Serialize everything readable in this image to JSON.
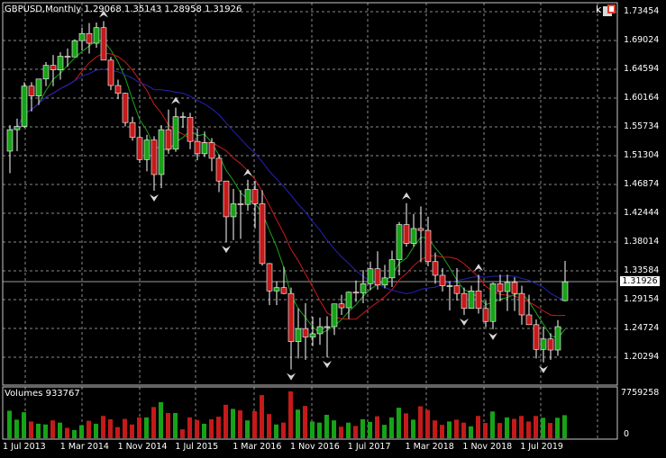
{
  "header": {
    "title": "GBPUSD,Monthly  1.29068 1.35143 1.28958 1.31926",
    "volume_label": "Volumes 933767",
    "corner_button": "k"
  },
  "price_axis": {
    "labels": [
      "1.73454",
      "1.69024",
      "1.64594",
      "1.60164",
      "1.55734",
      "1.51304",
      "1.46874",
      "1.42444",
      "1.38014",
      "1.33584",
      "1.29154",
      "1.24724",
      "1.20294"
    ],
    "current_price": "1.31926"
  },
  "volume_axis": {
    "labels": [
      "7759258",
      "0"
    ]
  },
  "time_axis": {
    "labels": [
      "1 Jul 2013",
      "1 Mar 2014",
      "1 Nov 2014",
      "1 Jul 2015",
      "1 Mar 2016",
      "1 Nov 2016",
      "1 Jul 2017",
      "1 Mar 2018",
      "1 Nov 2018",
      "1 Jul 2019"
    ]
  },
  "colors": {
    "bull": "#17a317",
    "bear": "#c41a1a",
    "ma_fast": "#1aa31a",
    "ma_mid": "#cc1a1a",
    "ma_slow": "#2323b8",
    "grid": "#8a8a8a"
  },
  "chart_data": {
    "type": "candlestick",
    "symbol": "GBPUSD",
    "timeframe": "Monthly",
    "start": "2013-07",
    "candles": [
      [
        1.52,
        1.56,
        1.486,
        1.553
      ],
      [
        1.553,
        1.57,
        1.52,
        1.558
      ],
      [
        1.558,
        1.626,
        1.556,
        1.62
      ],
      [
        1.62,
        1.626,
        1.581,
        1.605
      ],
      [
        1.605,
        1.63,
        1.591,
        1.631
      ],
      [
        1.631,
        1.657,
        1.62,
        1.652
      ],
      [
        1.652,
        1.668,
        1.62,
        1.645
      ],
      [
        1.645,
        1.672,
        1.63,
        1.666
      ],
      [
        1.666,
        1.678,
        1.65,
        1.665
      ],
      [
        1.665,
        1.692,
        1.67,
        1.69
      ],
      [
        1.69,
        1.71,
        1.675,
        1.701
      ],
      [
        1.701,
        1.717,
        1.67,
        1.686
      ],
      [
        1.686,
        1.718,
        1.679,
        1.71
      ],
      [
        1.71,
        1.72,
        1.66,
        1.66
      ],
      [
        1.66,
        1.665,
        1.614,
        1.621
      ],
      [
        1.621,
        1.63,
        1.6,
        1.609
      ],
      [
        1.609,
        1.61,
        1.558,
        1.564
      ],
      [
        1.564,
        1.573,
        1.536,
        1.541
      ],
      [
        1.541,
        1.558,
        1.502,
        1.507
      ],
      [
        1.507,
        1.545,
        1.489,
        1.537
      ],
      [
        1.537,
        1.543,
        1.459,
        1.484
      ],
      [
        1.484,
        1.56,
        1.463,
        1.553
      ],
      [
        1.553,
        1.584,
        1.516,
        1.523
      ],
      [
        1.523,
        1.587,
        1.519,
        1.573
      ],
      [
        1.573,
        1.58,
        1.556,
        1.572
      ],
      [
        1.572,
        1.579,
        1.523,
        1.535
      ],
      [
        1.535,
        1.555,
        1.506,
        1.516
      ],
      [
        1.516,
        1.55,
        1.511,
        1.533
      ],
      [
        1.533,
        1.54,
        1.489,
        1.509
      ],
      [
        1.509,
        1.515,
        1.457,
        1.474
      ],
      [
        1.474,
        1.47,
        1.38,
        1.419
      ],
      [
        1.419,
        1.462,
        1.383,
        1.439
      ],
      [
        1.439,
        1.46,
        1.385,
        1.438
      ],
      [
        1.438,
        1.476,
        1.428,
        1.461
      ],
      [
        1.461,
        1.474,
        1.401,
        1.439
      ],
      [
        1.439,
        1.46,
        1.344,
        1.347
      ],
      [
        1.347,
        1.348,
        1.283,
        1.305
      ],
      [
        1.305,
        1.32,
        1.283,
        1.31
      ],
      [
        1.31,
        1.342,
        1.3,
        1.301
      ],
      [
        1.301,
        1.31,
        1.184,
        1.227
      ],
      [
        1.227,
        1.278,
        1.201,
        1.247
      ],
      [
        1.247,
        1.286,
        1.199,
        1.234
      ],
      [
        1.234,
        1.265,
        1.22,
        1.239
      ],
      [
        1.239,
        1.264,
        1.222,
        1.25
      ],
      [
        1.25,
        1.266,
        1.203,
        1.25
      ],
      [
        1.25,
        1.285,
        1.237,
        1.285
      ],
      [
        1.285,
        1.299,
        1.268,
        1.279
      ],
      [
        1.279,
        1.304,
        1.262,
        1.303
      ],
      [
        1.303,
        1.321,
        1.288,
        1.302
      ],
      [
        1.302,
        1.337,
        1.286,
        1.316
      ],
      [
        1.316,
        1.35,
        1.306,
        1.339
      ],
      [
        1.339,
        1.366,
        1.307,
        1.314
      ],
      [
        1.314,
        1.345,
        1.309,
        1.325
      ],
      [
        1.325,
        1.367,
        1.311,
        1.353
      ],
      [
        1.353,
        1.411,
        1.329,
        1.407
      ],
      [
        1.407,
        1.44,
        1.373,
        1.378
      ],
      [
        1.378,
        1.423,
        1.373,
        1.401
      ],
      [
        1.401,
        1.435,
        1.349,
        1.398
      ],
      [
        1.398,
        1.419,
        1.343,
        1.35
      ],
      [
        1.35,
        1.364,
        1.316,
        1.329
      ],
      [
        1.329,
        1.34,
        1.304,
        1.313
      ],
      [
        1.313,
        1.32,
        1.275,
        1.313
      ],
      [
        1.313,
        1.34,
        1.29,
        1.301
      ],
      [
        1.301,
        1.31,
        1.268,
        1.278
      ],
      [
        1.278,
        1.313,
        1.281,
        1.305
      ],
      [
        1.305,
        1.33,
        1.27,
        1.278
      ],
      [
        1.278,
        1.29,
        1.249,
        1.258
      ],
      [
        1.258,
        1.318,
        1.246,
        1.316
      ],
      [
        1.316,
        1.33,
        1.289,
        1.304
      ],
      [
        1.304,
        1.33,
        1.274,
        1.318
      ],
      [
        1.318,
        1.326,
        1.274,
        1.301
      ],
      [
        1.301,
        1.313,
        1.253,
        1.268
      ],
      [
        1.268,
        1.299,
        1.254,
        1.253
      ],
      [
        1.253,
        1.261,
        1.201,
        1.215
      ],
      [
        1.215,
        1.25,
        1.195,
        1.231
      ],
      [
        1.231,
        1.24,
        1.199,
        1.214
      ],
      [
        1.214,
        1.26,
        1.205,
        1.25
      ],
      [
        1.29,
        1.351,
        1.289,
        1.319
      ]
    ]
  }
}
